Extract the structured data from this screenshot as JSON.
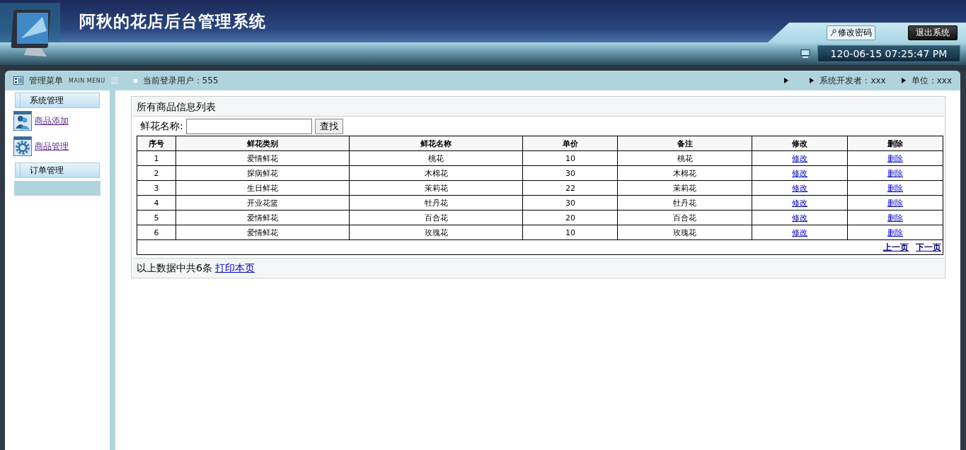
{
  "header": {
    "title": "阿秋的花店后台管理系统",
    "buttons": [
      {
        "label": "修改密码",
        "kind": "light"
      },
      {
        "label": "退出系统",
        "kind": "dark"
      }
    ],
    "datetime": "120-06-15 07:25:47 PM"
  },
  "topbar": {
    "menu_title": "管理菜单",
    "menu_subtitle": "MAIN MENU",
    "user": "当前登录用户：555",
    "developer": "系统开发者：xxx",
    "unit": "单位：xxx"
  },
  "sidebar": {
    "groups": [
      {
        "title": "系统管理",
        "items": [
          {
            "label": "商品添加"
          },
          {
            "label": "商品管理"
          }
        ]
      },
      {
        "title": "订单管理"
      }
    ]
  },
  "content": {
    "title": "所有商品信息列表",
    "search": {
      "label": "鲜花名称:",
      "button": "查找"
    },
    "table": {
      "columns": [
        "序号",
        "鲜花类别",
        "鲜花名称",
        "单价",
        "备注",
        "修改",
        "删除"
      ],
      "rows": [
        {
          "cells": [
            "1",
            "爱情鲜花",
            "桃花",
            "10",
            "桃花"
          ],
          "edit": "修改",
          "delete": "删除"
        },
        {
          "cells": [
            "2",
            "探病鲜花",
            "木棉花",
            "30",
            "木棉花"
          ],
          "edit": "修改",
          "delete": "删除"
        },
        {
          "cells": [
            "3",
            "生日鲜花",
            "茉莉花",
            "22",
            "茉莉花"
          ],
          "edit": "修改",
          "delete": "删除"
        },
        {
          "cells": [
            "4",
            "开业花篮",
            "牡丹花",
            "30",
            "牡丹花"
          ],
          "edit": "修改",
          "delete": "删除"
        },
        {
          "cells": [
            "5",
            "爱情鲜花",
            "百合花",
            "20",
            "百合花"
          ],
          "edit": "修改",
          "delete": "删除"
        },
        {
          "cells": [
            "6",
            "爱情鲜花",
            "玫瑰花",
            "10",
            "玫瑰花"
          ],
          "edit": "修改",
          "delete": "删除"
        }
      ],
      "pager": [
        "上一页",
        "下一页"
      ]
    },
    "footer": {
      "text": "以上数据中共6条",
      "link": "打印本页"
    }
  }
}
